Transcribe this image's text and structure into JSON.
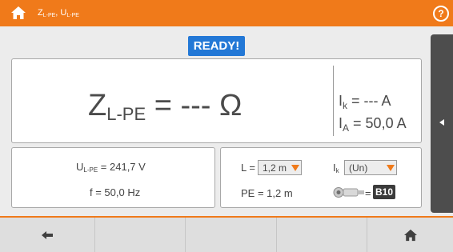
{
  "header": {
    "title_main": "Z",
    "title_sub1": "L-PE",
    "title_sep": ", U",
    "title_sub2": "L-PE",
    "help_label": "?"
  },
  "status": {
    "label": "READY!"
  },
  "main": {
    "z_symbol": "Z",
    "z_sub": "L-PE",
    "z_value": " = --- Ω",
    "ik_symbol": "I",
    "ik_sub": "k",
    "ik_value": " = --- A",
    "ia_symbol": "I",
    "ia_sub": "A",
    "ia_value": " = 50,0 A"
  },
  "measurements": {
    "u_symbol": "U",
    "u_sub": "L-PE",
    "u_value": " = 241,7 V",
    "frequency": "f = 50,0 Hz"
  },
  "settings": {
    "l_label": "L =",
    "l_value": "1,2 m",
    "ik_label_symbol": "I",
    "ik_label_sub": "k",
    "ik_mode": "(Un)",
    "pe_text": "PE = 1,2 m",
    "fuse_eq": "=",
    "fuse_type": "B10"
  },
  "colors": {
    "accent": "#f07a1a",
    "ready_bg": "#2378d6",
    "sidebar_bg": "#4d4d4d"
  },
  "icons": [
    "home-icon",
    "help-icon",
    "back-arrow-icon",
    "chevron-left-icon",
    "dropdown-arrow-icon",
    "cable-icon"
  ]
}
